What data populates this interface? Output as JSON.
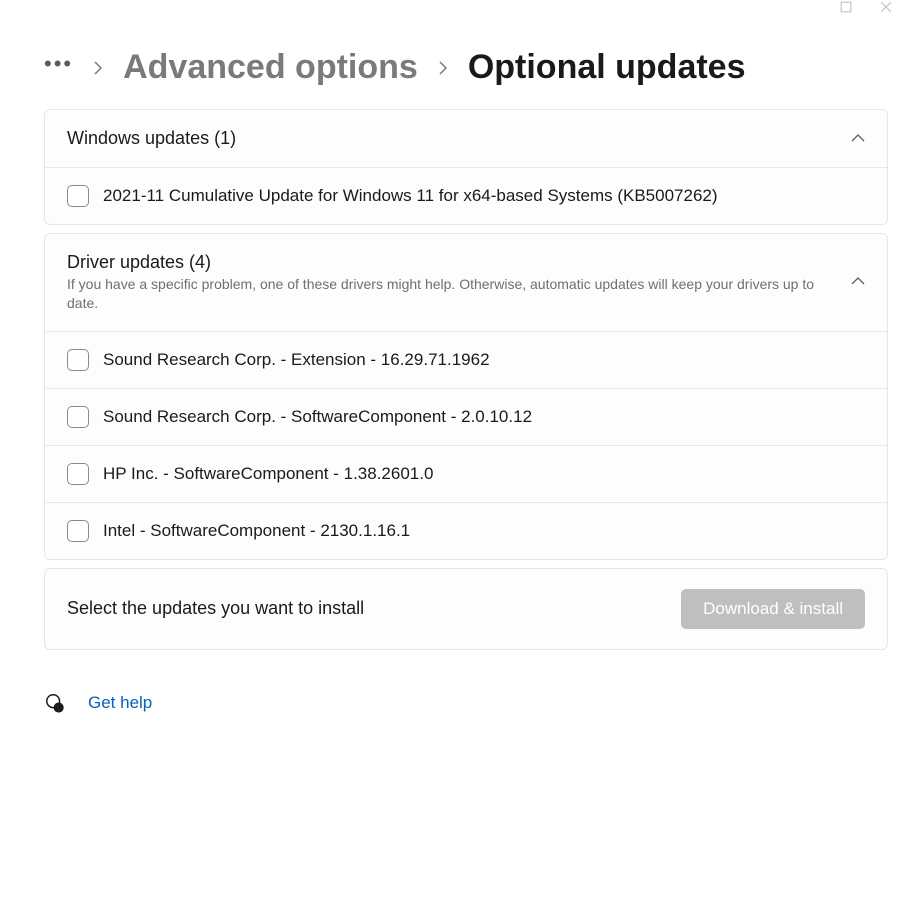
{
  "titlebar": {
    "maximize": "maximize",
    "close": "close"
  },
  "breadcrumb": {
    "more_label": "•••",
    "advanced_label": "Advanced options",
    "current_label": "Optional updates"
  },
  "sections": {
    "windows": {
      "title": "Windows updates (1)",
      "items": [
        {
          "label": "2021-11 Cumulative Update for Windows 11 for x64-based Systems (KB5007262)"
        }
      ]
    },
    "drivers": {
      "title": "Driver updates (4)",
      "subtitle": "If you have a specific problem, one of these drivers might help. Otherwise, automatic updates will keep your drivers up to date.",
      "items": [
        {
          "label": "Sound Research Corp. - Extension - 16.29.71.1962"
        },
        {
          "label": "Sound Research Corp. - SoftwareComponent - 2.0.10.12"
        },
        {
          "label": "HP Inc. - SoftwareComponent - 1.38.2601.0"
        },
        {
          "label": "Intel - SoftwareComponent - 2130.1.16.1"
        }
      ]
    }
  },
  "action": {
    "prompt": "Select the updates you want to install",
    "button": "Download & install"
  },
  "help": {
    "label": "Get help"
  }
}
